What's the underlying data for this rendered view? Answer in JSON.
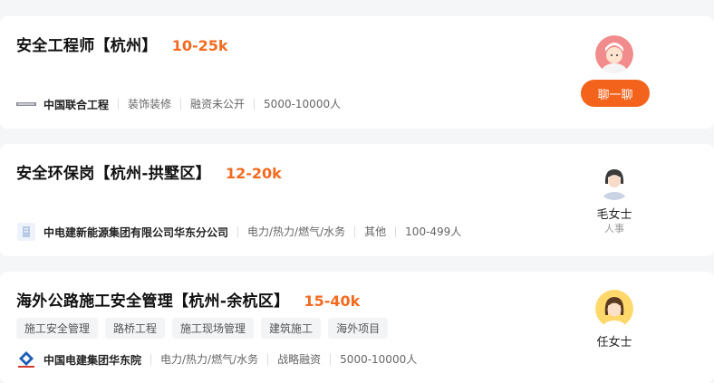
{
  "jobs": [
    {
      "title": "安全工程师【杭州】",
      "salary": "10-25k",
      "company": "中国联合工程",
      "meta": [
        "装饰装修",
        "融资未公开",
        "5000-10000人"
      ],
      "tags": [],
      "hr_name": "",
      "hr_role": "",
      "action_label": "聊一聊"
    },
    {
      "title": "安全环保岗【杭州-拱墅区】",
      "salary": "12-20k",
      "company": "中电建新能源集团有限公司华东分公司",
      "meta": [
        "电力/热力/燃气/水务",
        "其他",
        "100-499人"
      ],
      "tags": [],
      "hr_name": "毛女士",
      "hr_role": "人事"
    },
    {
      "title": "海外公路施工安全管理【杭州-余杭区】",
      "salary": "15-40k",
      "company": "中国电建集团华东院",
      "meta": [
        "电力/热力/燃气/水务",
        "战略融资",
        "5000-10000人"
      ],
      "tags": [
        "施工安全管理",
        "路桥工程",
        "施工现场管理",
        "建筑施工",
        "海外项目"
      ],
      "hr_name": "任女士",
      "hr_role": ""
    }
  ],
  "colors": {
    "salary": "#f26b21",
    "chat_button": "#f3631c"
  },
  "icons": {
    "logo1": "company-logo-icon",
    "logo2": "building-logo-icon",
    "logo3": "powerchina-logo-icon"
  }
}
